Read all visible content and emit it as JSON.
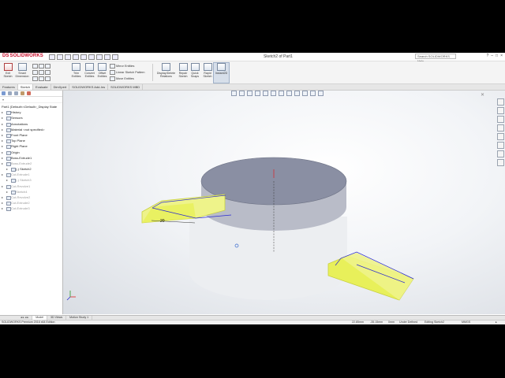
{
  "app": {
    "logo": "SOLIDWORKS",
    "logo_prefix": "DS",
    "document_title": "Sketch2 of Part1",
    "search_placeholder": "Search SOLIDWORKS Help",
    "window_controls": [
      "?",
      "–",
      "□",
      "×"
    ]
  },
  "ribbon": {
    "exit_sketch": "Exit Sketch",
    "smart_dimension": "Smart Dimension",
    "trim_entities": "Trim Entities",
    "convert_entities": "Convert Entities",
    "offset_entities": "Offset Entities",
    "mirror_entities": "Mirror Entities",
    "linear_sketch_pattern": "Linear Sketch Pattern",
    "move_entities": "Move Entities",
    "display_delete_relations": "Display/Delete Relations",
    "repair_sketch": "Repair Sketch",
    "quick_snaps": "Quick Snaps",
    "rapid_sketch": "Rapid Sketch",
    "instant2d": "Instant2D"
  },
  "command_tabs": [
    "Features",
    "Sketch",
    "Evaluate",
    "DimXpert",
    "SOLIDWORKS Add-Ins",
    "SOLIDWORKS MBD"
  ],
  "active_command_tab": "Sketch",
  "feature_tree": {
    "root": "Part1 (Default<<Default>_Display State",
    "items": [
      {
        "label": "History",
        "grey": false
      },
      {
        "label": "Sensors",
        "grey": false
      },
      {
        "label": "Annotations",
        "grey": false
      },
      {
        "label": "Material <not specified>",
        "grey": false
      },
      {
        "label": "Front Plane",
        "grey": false
      },
      {
        "label": "Top Plane",
        "grey": false
      },
      {
        "label": "Right Plane",
        "grey": false
      },
      {
        "label": "Origin",
        "grey": false
      },
      {
        "label": "Boss-Extrude1",
        "grey": false
      },
      {
        "label": "Boss-Extrude2",
        "grey": true
      },
      {
        "label": "(-) Sketch2",
        "grey": false
      },
      {
        "label": "Cut-Extrude1",
        "grey": true
      },
      {
        "label": "(-) Sketch3",
        "grey": true
      },
      {
        "label": "Cut-Revolve1",
        "grey": true
      },
      {
        "label": "Sketch4",
        "grey": true
      },
      {
        "label": "Cut-Revolve2",
        "grey": true
      },
      {
        "label": "Cut-Extrude2",
        "grey": true
      },
      {
        "label": "Cut-Extrude3",
        "grey": true
      }
    ]
  },
  "viewport": {
    "dimension_label": "20"
  },
  "bottom_tabs": [
    "Model",
    "3D Views",
    "Motion Study 1"
  ],
  "active_bottom_tab": "Model",
  "status": {
    "edition": "SOLIDWORKS Premium 2016 x64 Edition",
    "x": "22.85mm",
    "y": "-35.15mm",
    "z": "0mm",
    "state": "Under Defined",
    "editing": "Editing Sketch2",
    "units": "MMGS"
  },
  "colors": {
    "selection_yellow": "#e8f05a",
    "sketch_blue": "#2a2ad0",
    "body_grey": "#8a8fa3",
    "brand_red": "#c8102e"
  }
}
